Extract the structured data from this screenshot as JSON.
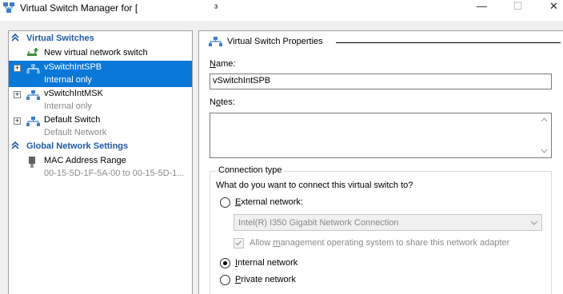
{
  "window": {
    "title": "Virtual Switch Manager for [",
    "title_tail": "³",
    "min_glyph": "—",
    "max_glyph": "☐",
    "close_glyph": "✕"
  },
  "left": {
    "virtual_switches_header": "Virtual Switches",
    "new_switch_label": "New virtual network switch",
    "switches": [
      {
        "name": "vSwitchIntSPB",
        "type": "Internal only",
        "expander": "+"
      },
      {
        "name": "vSwitchIntMSK",
        "type": "Internal only",
        "expander": "+"
      },
      {
        "name": "Default Switch",
        "type": "Default Network",
        "expander": "+"
      }
    ],
    "global_header": "Global Network Settings",
    "mac": {
      "name": "MAC Address Range",
      "value": "00-15-5D-1F-5A-00 to 00-15-5D-1..."
    }
  },
  "right": {
    "properties_title": "Virtual Switch Properties",
    "name_label_key": "N",
    "name_label_rest": "ame:",
    "name_value": "vSwitchIntSPB",
    "notes_label_pre": "N",
    "notes_label_key": "o",
    "notes_label_rest": "tes:",
    "connection_type_title": "Connection type",
    "question": "What do you want to connect this virtual switch to?",
    "external_key": "E",
    "external_rest": "xternal network:",
    "adapter_value": "Intel(R) I350 Gigabit Network Connection",
    "allow_pre": "Allow ",
    "allow_key": "m",
    "allow_rest": "anagement operating system to share this network adapter",
    "internal_key": "I",
    "internal_rest": "nternal network",
    "private_key": "P",
    "private_rest": "rivate network",
    "selected": "internal"
  },
  "colors": {
    "selection": "#0a78d7",
    "header_text": "#1e5aa8",
    "disabled_text": "#8a8a8a"
  },
  "icons": [
    "app-icon",
    "collapse-chevron-icon",
    "network-switch-icon",
    "new-switch-icon",
    "mac-address-icon",
    "combo-dropdown-icon",
    "scroll-up-icon",
    "scroll-down-icon"
  ]
}
